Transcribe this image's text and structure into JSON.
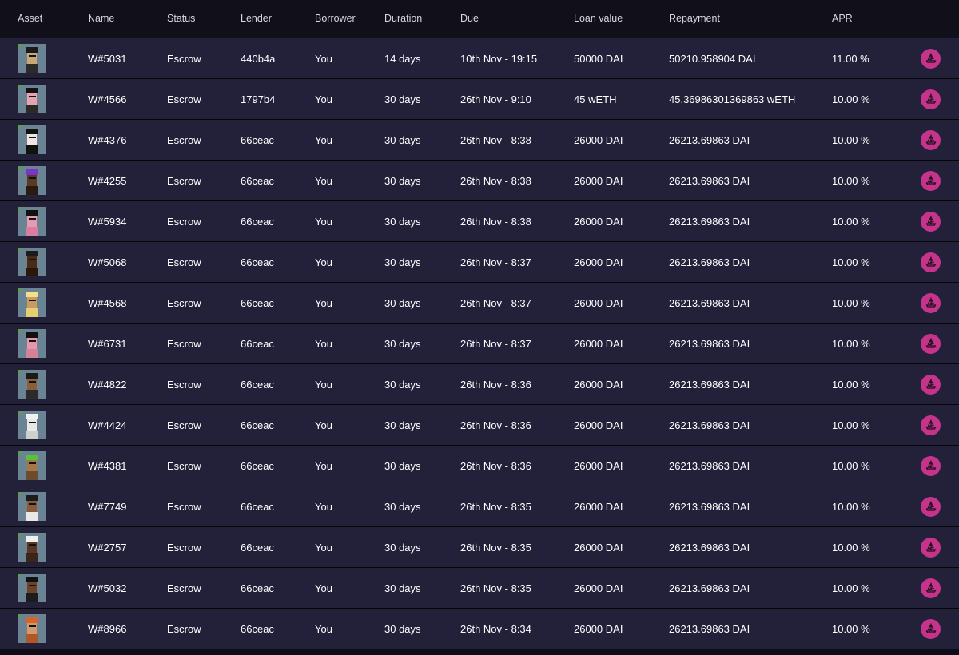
{
  "columns": {
    "asset": "Asset",
    "name": "Name",
    "status": "Status",
    "lender": "Lender",
    "borrower": "Borrower",
    "duration": "Duration",
    "due": "Due",
    "loan": "Loan value",
    "repayment": "Repayment",
    "apr": "APR"
  },
  "colors": {
    "header_bg": "#110f19",
    "row_bg": "#23203a",
    "action_accent": "#c6338a",
    "avatar_bg": "#6a8494"
  },
  "action_icon": "opensea-ship-icon",
  "rows": [
    {
      "name": "W#5031",
      "status": "Escrow",
      "lender": "440b4a",
      "borrower": "You",
      "duration": "14 days",
      "due": "10th Nov - 19:15",
      "loan": "50000 DAI",
      "repayment": "50210.958904 DAI",
      "apr": "11.00 %",
      "avatar": {
        "hair": "#1a1a1a",
        "face": "#c9a878",
        "body": "#2b2b2b"
      }
    },
    {
      "name": "W#4566",
      "status": "Escrow",
      "lender": "1797b4",
      "borrower": "You",
      "duration": "30 days",
      "due": "26th Nov - 9:10",
      "loan": "45 wETH",
      "repayment": "45.36986301369863 wETH",
      "apr": "10.00 %",
      "avatar": {
        "hair": "#111111",
        "face": "#e7a3b1",
        "body": "#2a2a2a"
      }
    },
    {
      "name": "W#4376",
      "status": "Escrow",
      "lender": "66ceac",
      "borrower": "You",
      "duration": "30 days",
      "due": "26th Nov - 8:38",
      "loan": "26000 DAI",
      "repayment": "26213.69863 DAI",
      "apr": "10.00 %",
      "avatar": {
        "hair": "#121212",
        "face": "#f0e6e6",
        "body": "#111111"
      }
    },
    {
      "name": "W#4255",
      "status": "Escrow",
      "lender": "66ceac",
      "borrower": "You",
      "duration": "30 days",
      "due": "26th Nov - 8:38",
      "loan": "26000 DAI",
      "repayment": "26213.69863 DAI",
      "apr": "10.00 %",
      "avatar": {
        "hair": "#7a35c6",
        "face": "#5a3a23",
        "body": "#2a1b12"
      }
    },
    {
      "name": "W#5934",
      "status": "Escrow",
      "lender": "66ceac",
      "borrower": "You",
      "duration": "30 days",
      "due": "26th Nov - 8:38",
      "loan": "26000 DAI",
      "repayment": "26213.69863 DAI",
      "apr": "10.00 %",
      "avatar": {
        "hair": "#111111",
        "face": "#e79ab4",
        "body": "#d97ea2"
      }
    },
    {
      "name": "W#5068",
      "status": "Escrow",
      "lender": "66ceac",
      "borrower": "You",
      "duration": "30 days",
      "due": "26th Nov - 8:37",
      "loan": "26000 DAI",
      "repayment": "26213.69863 DAI",
      "apr": "10.00 %",
      "avatar": {
        "hair": "#1b1b1b",
        "face": "#4b2a16",
        "body": "#2a160a"
      }
    },
    {
      "name": "W#4568",
      "status": "Escrow",
      "lender": "66ceac",
      "borrower": "You",
      "duration": "30 days",
      "due": "26th Nov - 8:37",
      "loan": "26000 DAI",
      "repayment": "26213.69863 DAI",
      "apr": "10.00 %",
      "avatar": {
        "hair": "#f2e08a",
        "face": "#c99a62",
        "body": "#e4d070"
      }
    },
    {
      "name": "W#6731",
      "status": "Escrow",
      "lender": "66ceac",
      "borrower": "You",
      "duration": "30 days",
      "due": "26th Nov - 8:37",
      "loan": "26000 DAI",
      "repayment": "26213.69863 DAI",
      "apr": "10.00 %",
      "avatar": {
        "hair": "#111111",
        "face": "#e797ad",
        "body": "#d4829a"
      }
    },
    {
      "name": "W#4822",
      "status": "Escrow",
      "lender": "66ceac",
      "borrower": "You",
      "duration": "30 days",
      "due": "26th Nov - 8:36",
      "loan": "26000 DAI",
      "repayment": "26213.69863 DAI",
      "apr": "10.00 %",
      "avatar": {
        "hair": "#1a1a1a",
        "face": "#8b5e3c",
        "body": "#2b2b2b"
      }
    },
    {
      "name": "W#4424",
      "status": "Escrow",
      "lender": "66ceac",
      "borrower": "You",
      "duration": "30 days",
      "due": "26th Nov - 8:36",
      "loan": "26000 DAI",
      "repayment": "26213.69863 DAI",
      "apr": "10.00 %",
      "avatar": {
        "hair": "#f0f0f0",
        "face": "#e8e8e8",
        "body": "#cfcfcf"
      }
    },
    {
      "name": "W#4381",
      "status": "Escrow",
      "lender": "66ceac",
      "borrower": "You",
      "duration": "30 days",
      "due": "26th Nov - 8:36",
      "loan": "26000 DAI",
      "repayment": "26213.69863 DAI",
      "apr": "10.00 %",
      "avatar": {
        "hair": "#58c23b",
        "face": "#a77847",
        "body": "#6b4c2c"
      }
    },
    {
      "name": "W#7749",
      "status": "Escrow",
      "lender": "66ceac",
      "borrower": "You",
      "duration": "30 days",
      "due": "26th Nov - 8:35",
      "loan": "26000 DAI",
      "repayment": "26213.69863 DAI",
      "apr": "10.00 %",
      "avatar": {
        "hair": "#1c1c1c",
        "face": "#8a5a3a",
        "body": "#e8e8e8"
      }
    },
    {
      "name": "W#2757",
      "status": "Escrow",
      "lender": "66ceac",
      "borrower": "You",
      "duration": "30 days",
      "due": "26th Nov - 8:35",
      "loan": "26000 DAI",
      "repayment": "26213.69863 DAI",
      "apr": "10.00 %",
      "avatar": {
        "hair": "#efefef",
        "face": "#5a3622",
        "body": "#3b2418"
      }
    },
    {
      "name": "W#5032",
      "status": "Escrow",
      "lender": "66ceac",
      "borrower": "You",
      "duration": "30 days",
      "due": "26th Nov - 8:35",
      "loan": "26000 DAI",
      "repayment": "26213.69863 DAI",
      "apr": "10.00 %",
      "avatar": {
        "hair": "#111111",
        "face": "#6b4329",
        "body": "#1c1c1c"
      }
    },
    {
      "name": "W#8966",
      "status": "Escrow",
      "lender": "66ceac",
      "borrower": "You",
      "duration": "30 days",
      "due": "26th Nov - 8:34",
      "loan": "26000 DAI",
      "repayment": "26213.69863 DAI",
      "apr": "10.00 %",
      "avatar": {
        "hair": "#d8642a",
        "face": "#d59a6a",
        "body": "#b0572a"
      }
    }
  ]
}
